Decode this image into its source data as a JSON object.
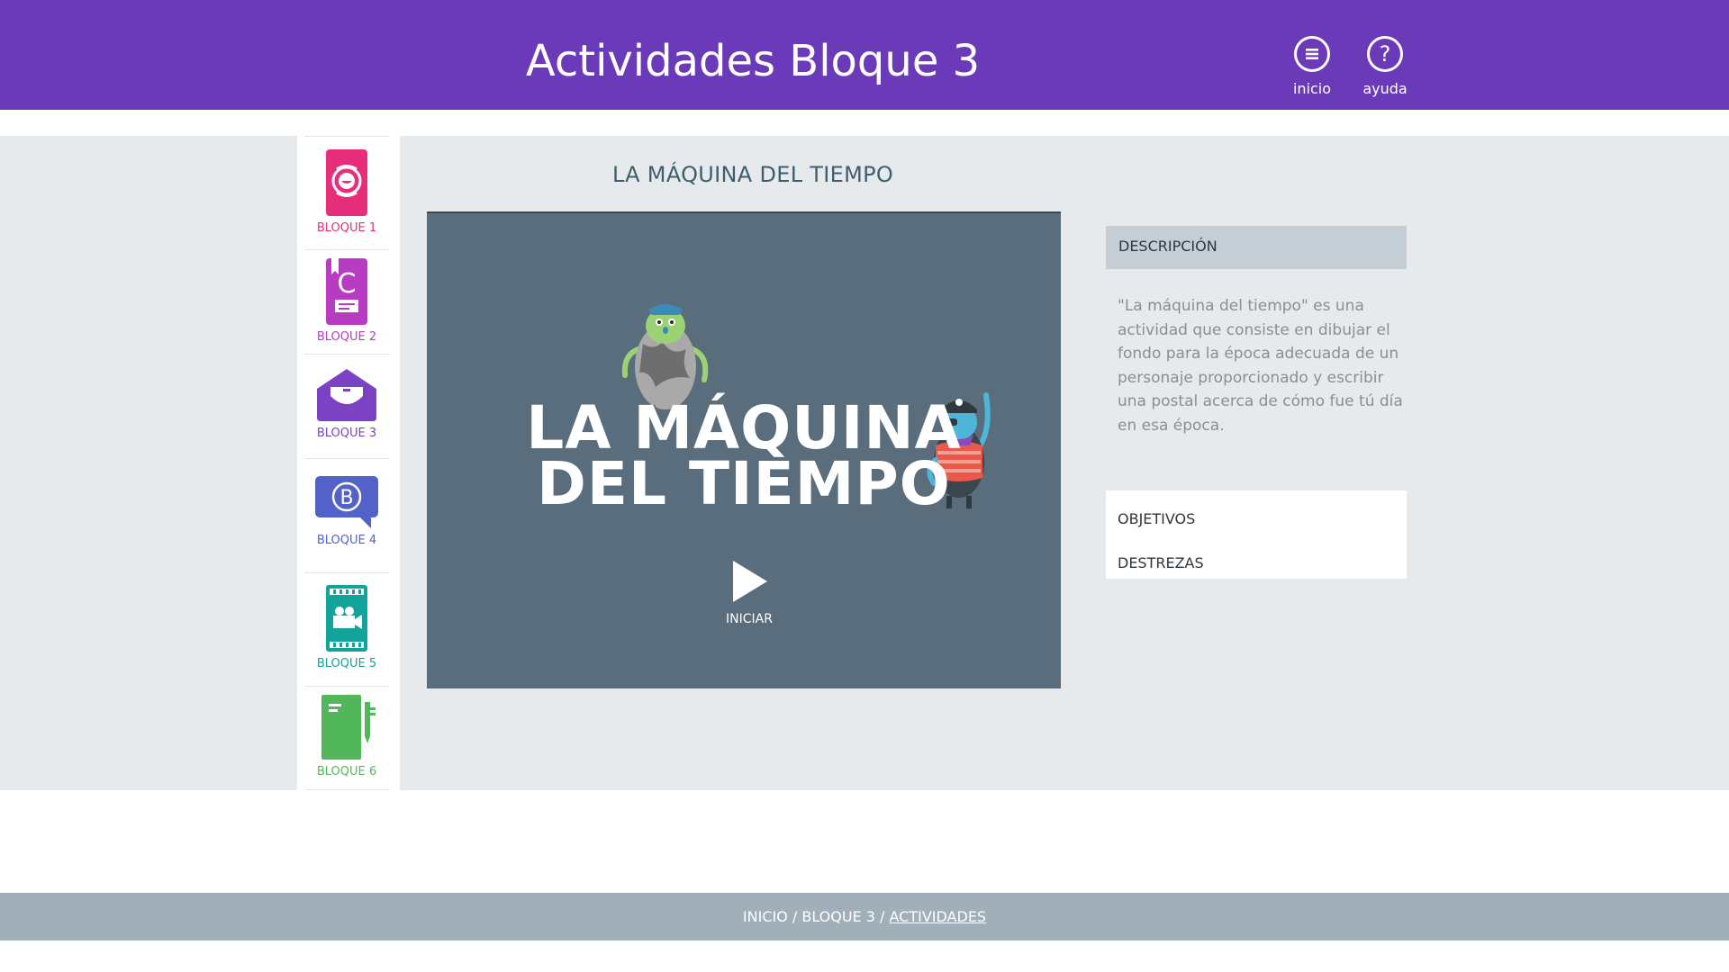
{
  "header": {
    "title": "Actividades Bloque 3",
    "buttons": [
      {
        "label": "inicio",
        "icon": "menu-icon"
      },
      {
        "label": "ayuda",
        "icon": "help-icon"
      }
    ]
  },
  "sidebar": {
    "items": [
      {
        "label": "BLOQUE 1",
        "color": "#e62e7a",
        "icon": "face-book-icon"
      },
      {
        "label": "BLOQUE 2",
        "color": "#b73cc2",
        "icon": "letter-c-book-icon"
      },
      {
        "label": "BLOQUE 3",
        "color": "#7b43c4",
        "icon": "envelope-heart-icon"
      },
      {
        "label": "BLOQUE 4",
        "color": "#5362c8",
        "icon": "speech-bubble-b-icon"
      },
      {
        "label": "BLOQUE 5",
        "color": "#12a39a",
        "icon": "film-camera-icon"
      },
      {
        "label": "BLOQUE 6",
        "color": "#52b75b",
        "icon": "notebook-pen-icon"
      }
    ]
  },
  "activity": {
    "title": "LA MÁQUINA DEL TIEMPO",
    "video": {
      "title_line1": "LA MÁQUINA",
      "title_line2": "DEL TIEMPO",
      "play_label": "INICIAR",
      "bg_color": "#596d7c"
    }
  },
  "panel": {
    "description_header": "DESCRIPCIÓN",
    "description_text": "\"La máquina del tiempo\" es una actividad que consiste en dibujar el fondo para la época adecuada de un personaje proporcionado y escribir una postal acerca de cómo fue tú día en esa época.",
    "links": [
      "OBJETIVOS",
      "DESTREZAS"
    ]
  },
  "footer": {
    "breadcrumb": [
      "INICIO",
      "BLOQUE 3",
      "ACTIVIDADES"
    ],
    "separator": " / "
  },
  "colors": {
    "header_bg": "#6a3ab8",
    "content_bg": "#e7eaed",
    "footer_bg": "#a1afb9"
  }
}
